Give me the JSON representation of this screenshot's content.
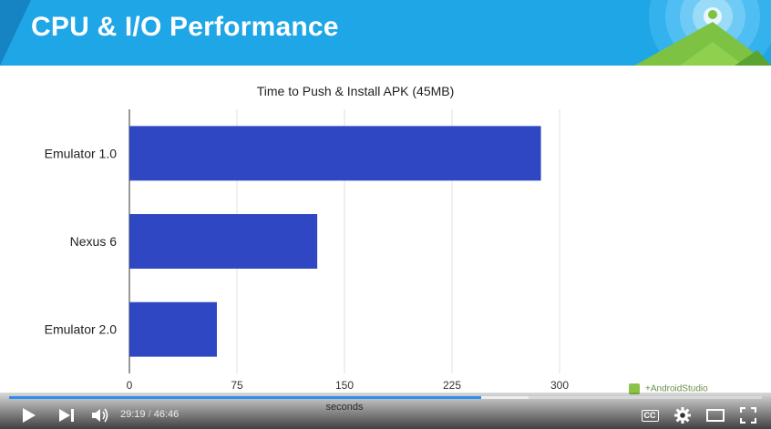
{
  "slide": {
    "title": "CPU & I/O Performance"
  },
  "chart_data": {
    "type": "bar",
    "orientation": "horizontal",
    "title": "Time to Push & Install APK (45MB)",
    "categories": [
      "Emulator 1.0",
      "Nexus 6",
      "Emulator 2.0"
    ],
    "values": [
      287,
      131,
      61
    ],
    "xlabel": "seconds",
    "ylabel": "",
    "xlim": [
      0,
      300
    ],
    "xticks": [
      "0",
      "75",
      "150",
      "225",
      "300"
    ],
    "bar_color": "#2f47c2",
    "grid": true,
    "legend": "none"
  },
  "player": {
    "current_time": "29:19",
    "separator": "/",
    "duration": "46:46",
    "progress_fraction": 0.627,
    "buffered_fraction": 0.69,
    "accent_color": "#2f8df0",
    "icons": [
      "play-icon",
      "next-icon",
      "volume-icon",
      "cc-icon",
      "settings-icon",
      "theater-icon",
      "fullscreen-icon"
    ],
    "cc_label": "CC"
  },
  "watermark": {
    "text": "+AndroidStudio"
  }
}
